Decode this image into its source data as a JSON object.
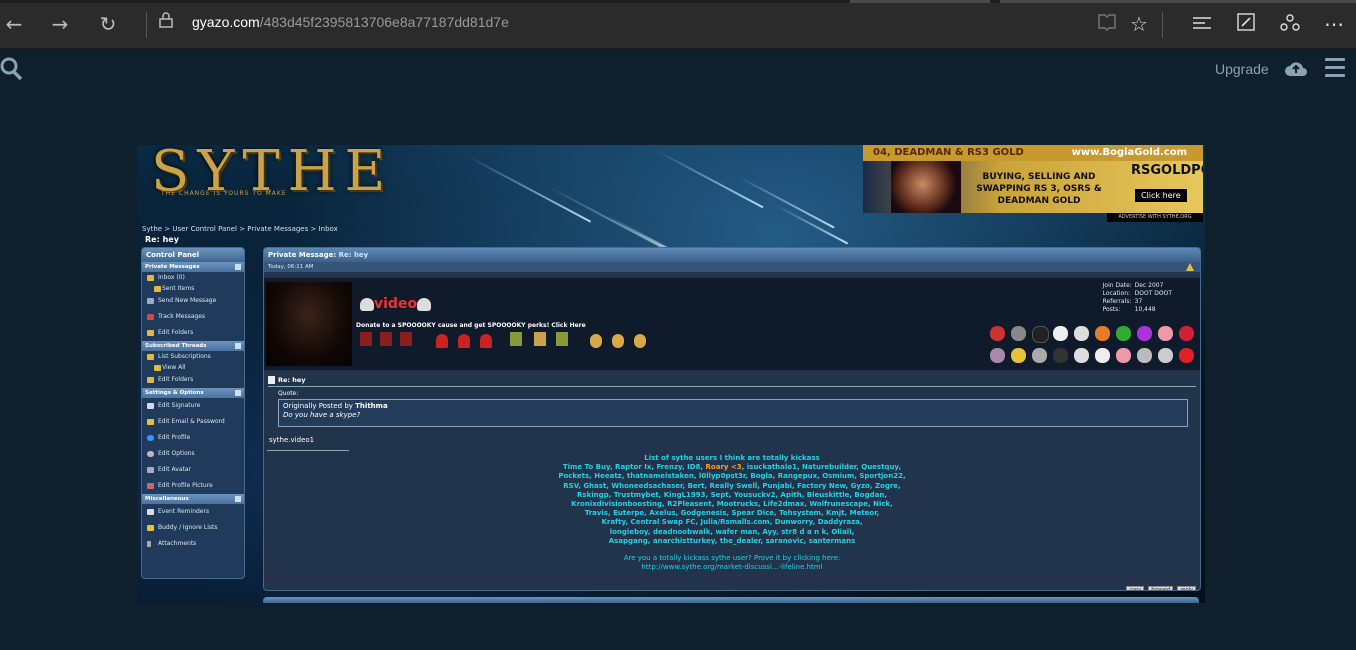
{
  "browser": {
    "url_host": "gyazo.com",
    "url_path": "/483d45f2395813706e8a77187dd81d7e"
  },
  "gyazo": {
    "upgrade_label": "Upgrade"
  },
  "site": {
    "logo": "SYTHE",
    "logo_sub": "THE CHANGE IS YOURS TO MAKE",
    "ad": {
      "top_left": "04, DEADMAN & RS3 GOLD",
      "top_right": "www.BogiaGold.com",
      "headline": "BUYING, SELLING AND SWAPPING RS 3, OSRS & DEADMAN GOLD",
      "brand": "RSGOLDPOT",
      "cta": "Click here",
      "footer": "ADVERTISE WITH SYTHE.ORG"
    },
    "breadcrumb": "Sythe > User Control Panel > Private Messages > Inbox",
    "breadcrumb_current": "Re: hey"
  },
  "control_panel": {
    "title": "Control Panel",
    "sections": [
      {
        "title": "Private Messages",
        "items": [
          "Inbox (0)",
          "Sent Items",
          "Send New Message",
          "Track Messages",
          "Edit Folders"
        ]
      },
      {
        "title": "Subscribed Threads",
        "items": [
          "List Subscriptions",
          "View All",
          "Edit Folders"
        ]
      },
      {
        "title": "Settings & Options",
        "items": [
          "Edit Signature",
          "Edit Email & Password",
          "Edit Profile",
          "Edit Options",
          "Edit Avatar",
          "Edit Profile Picture"
        ]
      },
      {
        "title": "Miscellaneous",
        "items": [
          "Event Reminders",
          "Buddy / Ignore Lists",
          "Attachments"
        ]
      }
    ]
  },
  "message": {
    "panel_title": "Private Message:",
    "panel_subject": "Re: hey",
    "date": "Today, 06:11 AM",
    "username": "video",
    "donate_text": "Donate to a SPOOOOKY cause and get SPOOOOKY perks! Click Here",
    "join_date_label": "Join Date:",
    "join_date": "Dec 2007",
    "location_label": "Location:",
    "location": "DOOT DOOT",
    "referrals_label": "Referrals:",
    "referrals": "37",
    "posts_label": "Posts:",
    "posts": "10,448",
    "title": "Re: hey",
    "quote_label": "Quote:",
    "quote_by_prefix": "Originally Posted by",
    "quote_author": "Thithma",
    "quote_text": "Do you have a skype?",
    "reply_text": "sythe.video1",
    "sig_heading": "List of sythe users I think are totally kickass",
    "sig_lines": [
      "Time To Buy, Raptor Ix, Frenzy, ID8,",
      "Pockets, Heeatz, thatnameistaken, l0llyp0pst3r, Bogla, Rangepux, Osmium, Sportjon22,",
      "RSV, Ghast, Whoneedsachaser, Bert, Really Swell, Punjabi, Factory New, Gyzo, Zogre,",
      "Rskingp, Trustmybet, KingL1993, Sept, Yousuckv2, Apith, Bleuskittle, Bogdan,",
      "Kronixdivisionboosting, R2Pleasent, Mootrucks, Life2dmax, Wolfrunescape, Nick,",
      "Travis, Euterpe, Axelus, Godgenesis, Spear Dice, Tehsystem, Kmjt, Meteor,",
      "Krafty, Central Swap FC, Julia/Rsmalls.com, Dunworry, Daddyraza,",
      "longieboy, deadnoobwalk, wafer man, Ayy, str8 d a n k, Oliali,",
      "Asapgang, anarchistturkey, the_dealer, saranovic, santermans"
    ],
    "sig_roary": "Roary <3",
    "sig_line1_rest": ", isuckathalo1, Naturebuilder, Questquy,",
    "sig_ask": "Are you a totally kickass sythe user? Prove it by clicking here:",
    "sig_link": "http://www.sythe.org/market-discussi...-lifeline.html",
    "buttons": [
      "copy",
      "forward",
      "reply"
    ]
  }
}
